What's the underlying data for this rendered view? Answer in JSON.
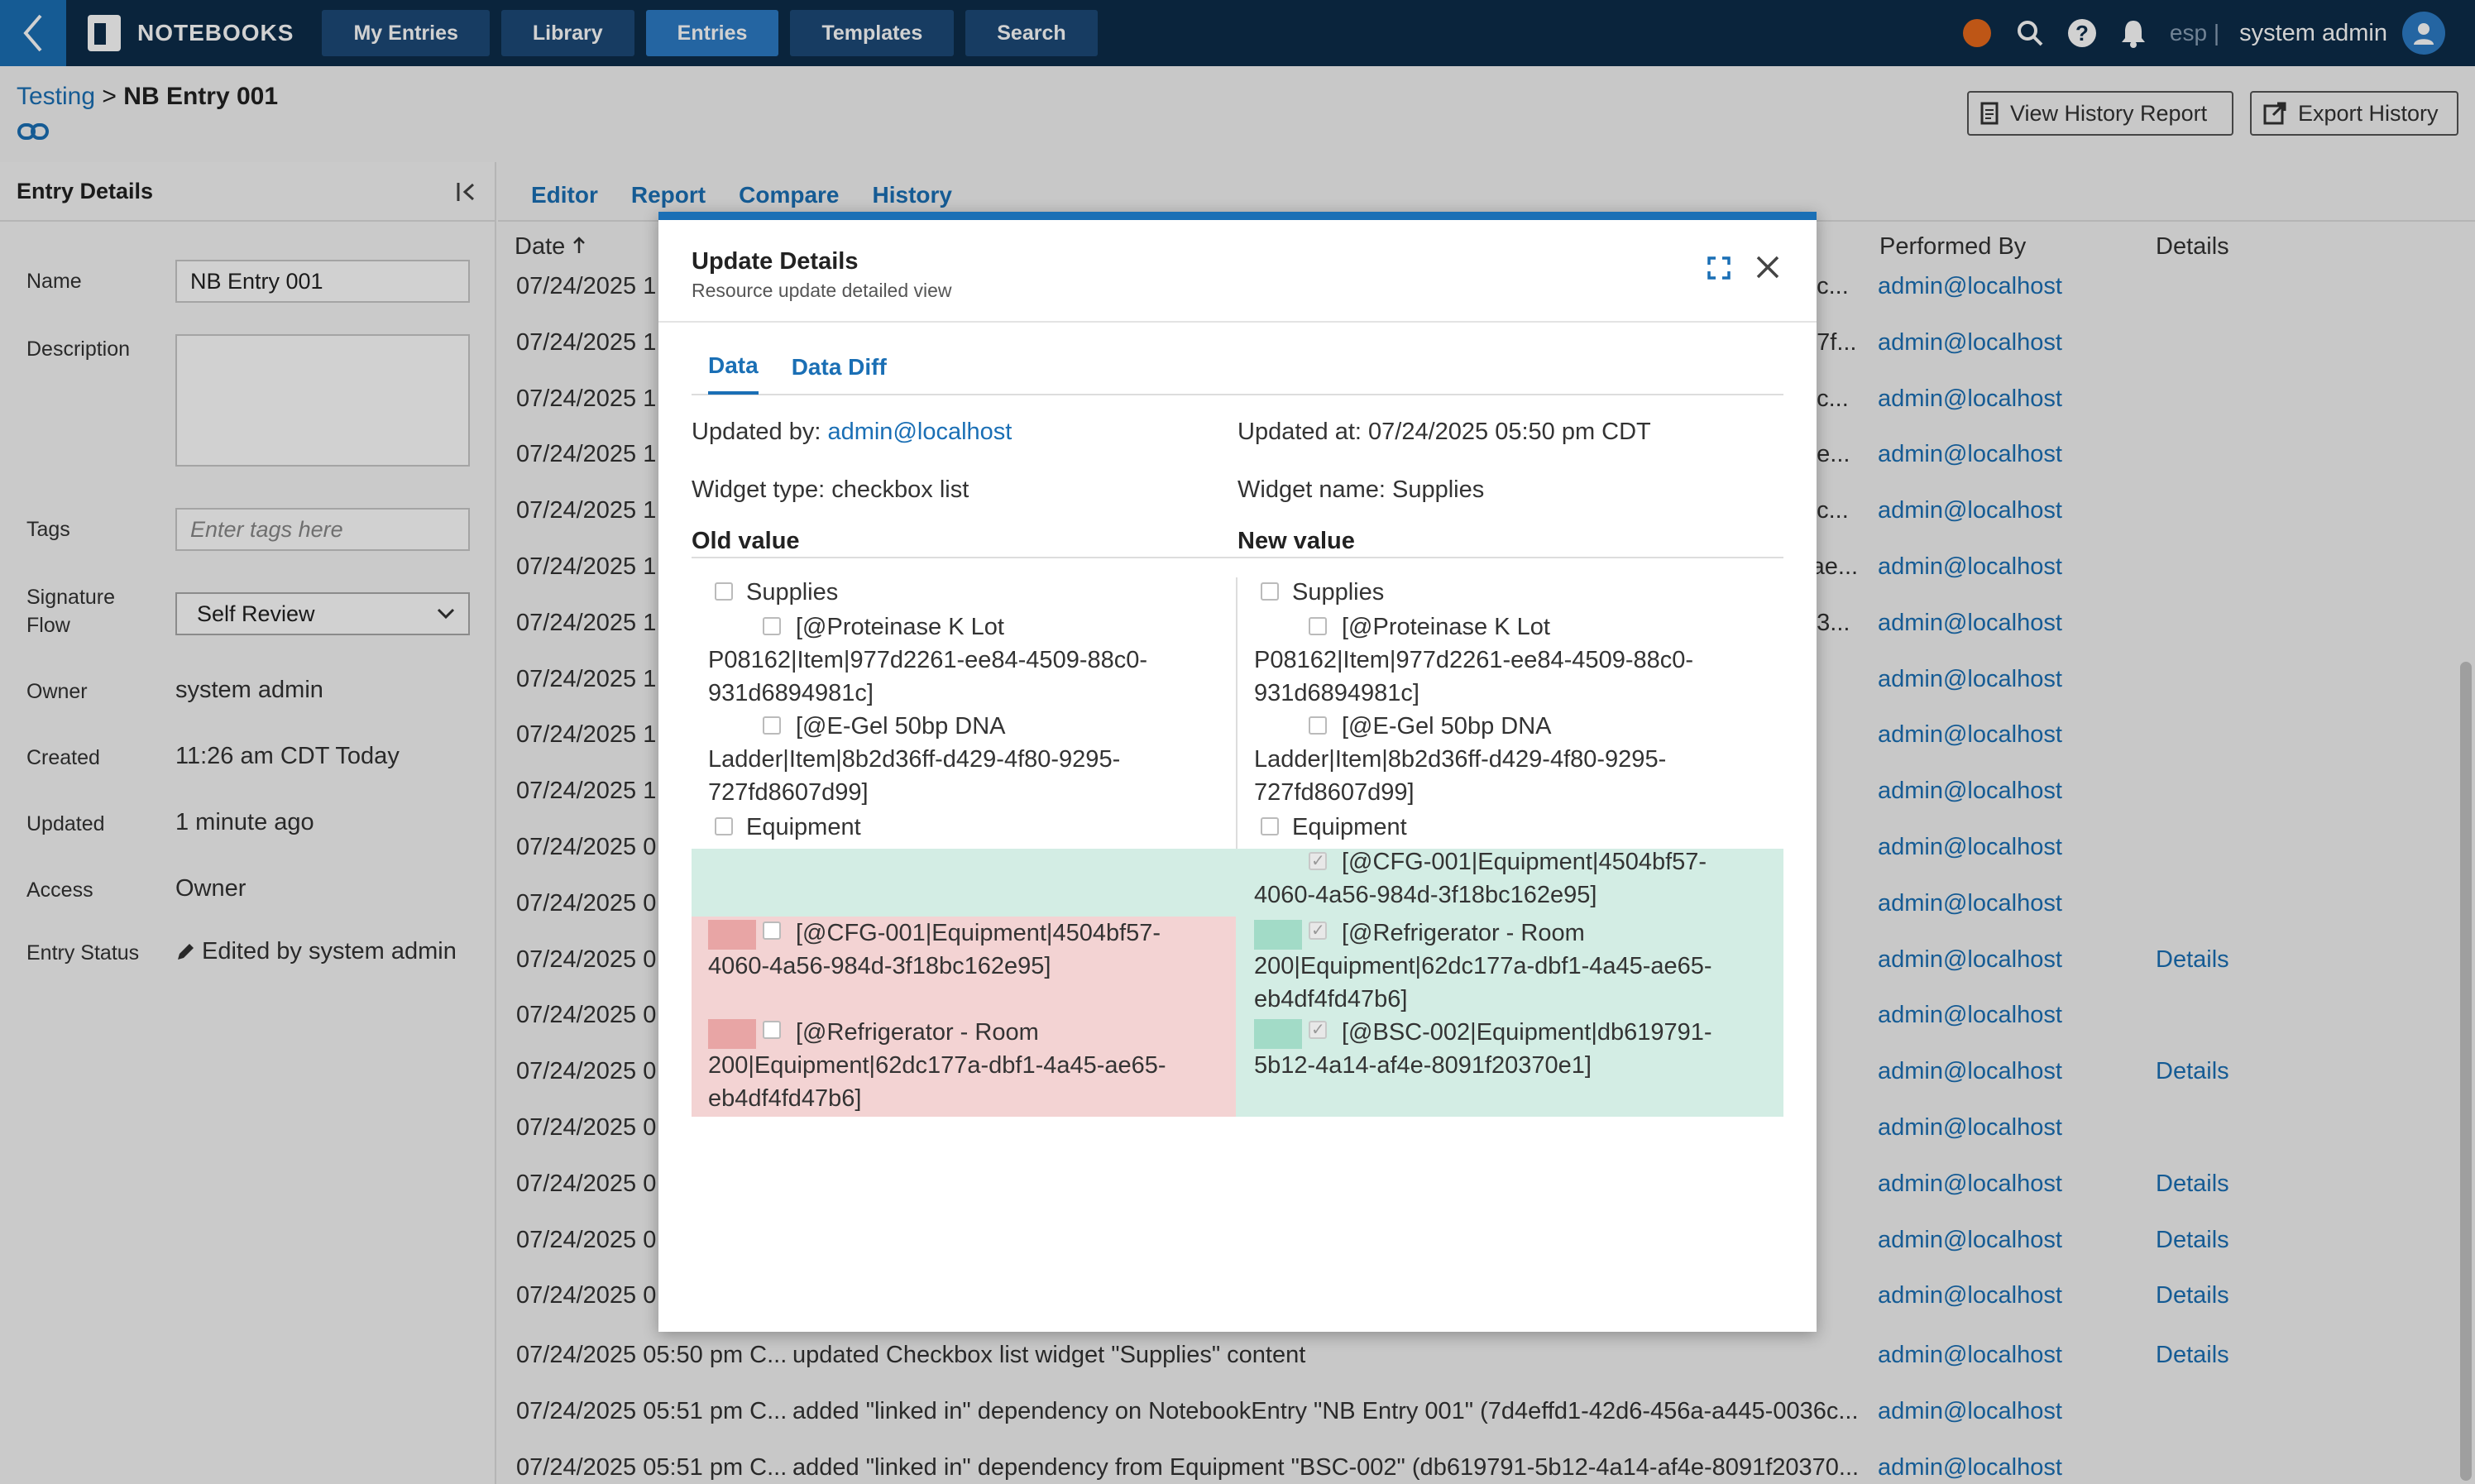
{
  "topbar": {
    "brand": "NOTEBOOKS",
    "nav": [
      "My Entries",
      "Library",
      "Entries",
      "Templates",
      "Search"
    ],
    "active_nav": "Entries",
    "lang": "esp |",
    "user": "system admin",
    "colors": {
      "bar": "#0d2c4a",
      "accent": "#1a6fb5",
      "status_dot": "#e86a1c"
    }
  },
  "breadcrumb": {
    "parent": "Testing",
    "sep": ">",
    "current": "NB Entry 001"
  },
  "header_buttons": {
    "view_history": "View History Report",
    "export_history": "Export History"
  },
  "left_panel": {
    "title": "Entry Details",
    "name_label": "Name",
    "name_value": "NB Entry 001",
    "description_label": "Description",
    "tags_label": "Tags",
    "tags_placeholder": "Enter tags here",
    "signature_label_1": "Signature",
    "signature_label_2": "Flow",
    "signature_value": "Self Review",
    "owner_label": "Owner",
    "owner_value": "system admin",
    "created_label": "Created",
    "created_value": "11:26 am CDT Today",
    "updated_label": "Updated",
    "updated_value": "1 minute ago",
    "access_label": "Access",
    "access_value": "Owner",
    "status_label": "Entry Status",
    "status_value": "Edited by system admin"
  },
  "main_tabs": [
    "Editor",
    "Report",
    "Compare",
    "History"
  ],
  "table": {
    "headers": {
      "date": "Date",
      "performed_by": "Performed By",
      "details": "Details"
    },
    "rows": [
      {
        "date": "07/24/2025 1",
        "frag": "6c...",
        "by": "admin@localhost",
        "details": ""
      },
      {
        "date": "07/24/2025 1",
        "frag": "27f...",
        "by": "admin@localhost",
        "details": ""
      },
      {
        "date": "07/24/2025 1",
        "frag": "6c...",
        "by": "admin@localhost",
        "details": ""
      },
      {
        "date": "07/24/2025 1",
        "frag": "2e...",
        "by": "admin@localhost",
        "details": ""
      },
      {
        "date": "07/24/2025 1",
        "frag": "6c...",
        "by": "admin@localhost",
        "details": ""
      },
      {
        "date": "07/24/2025 1",
        "frag": "-ae...",
        "by": "admin@localhost",
        "details": ""
      },
      {
        "date": "07/24/2025 1",
        "frag": "03...",
        "by": "admin@localhost",
        "details": ""
      },
      {
        "date": "07/24/2025 1",
        "frag": "",
        "by": "admin@localhost",
        "details": ""
      },
      {
        "date": "07/24/2025 1",
        "frag": "\"",
        "by": "admin@localhost",
        "details": ""
      },
      {
        "date": "07/24/2025 1",
        "frag": "",
        "by": "admin@localhost",
        "details": ""
      },
      {
        "date": "07/24/2025 0",
        "frag": "",
        "by": "admin@localhost",
        "details": ""
      },
      {
        "date": "07/24/2025 0",
        "frag": "",
        "by": "admin@localhost",
        "details": ""
      },
      {
        "date": "07/24/2025 0",
        "frag": "",
        "by": "admin@localhost",
        "details": "Details"
      },
      {
        "date": "07/24/2025 0",
        "frag": "",
        "by": "admin@localhost",
        "details": ""
      },
      {
        "date": "07/24/2025 0",
        "frag": "",
        "by": "admin@localhost",
        "details": "Details"
      },
      {
        "date": "07/24/2025 0",
        "frag": "",
        "by": "admin@localhost",
        "details": ""
      },
      {
        "date": "07/24/2025 0",
        "frag": "",
        "by": "admin@localhost",
        "details": "Details"
      },
      {
        "date": "07/24/2025 0",
        "frag": "",
        "by": "admin@localhost",
        "details": "Details"
      },
      {
        "date": "07/24/2025 0",
        "frag": "",
        "by": "admin@localhost",
        "details": "Details"
      }
    ],
    "bottom_rows": [
      {
        "date": "07/24/2025 05:50 pm C...",
        "desc": "updated Checkbox list widget \"Supplies\" content",
        "by": "admin@localhost",
        "details": "Details"
      },
      {
        "date": "07/24/2025 05:51 pm C...",
        "desc": "added \"linked in\" dependency on NotebookEntry \"NB Entry 001\" (7d4effd1-42d6-456a-a445-0036c...",
        "by": "admin@localhost",
        "details": ""
      },
      {
        "date": "07/24/2025 05:51 pm C...",
        "desc": "added \"linked in\" dependency from Equipment \"BSC-002\" (db619791-5b12-4a14-af4e-8091f20370...",
        "by": "admin@localhost",
        "details": ""
      }
    ]
  },
  "modal": {
    "title": "Update Details",
    "subtitle": "Resource update detailed view",
    "tabs": [
      "Data",
      "Data Diff"
    ],
    "updated_by_label": "Updated by:",
    "updated_by": "admin@localhost",
    "updated_at": "Updated at: 07/24/2025 05:50 pm CDT",
    "widget_type": "Widget type: checkbox list",
    "widget_name": "Widget name: Supplies",
    "old_header": "Old value",
    "new_header": "New value",
    "common_lines": {
      "supplies": "Supplies",
      "pk_1": "[@Proteinase K Lot",
      "pk_2": "P08162|Item|977d2261-ee84-4509-88c0-",
      "pk_3": "931d6894981c]",
      "egel_1": "[@E-Gel 50bp DNA",
      "egel_2": "Ladder|Item|8b2d36ff-d429-4f80-9295-",
      "egel_3": "727fd8607d99]",
      "equipment": "Equipment"
    },
    "old_removed": {
      "cfg_1": "[@CFG-001|Equipment|4504bf57-",
      "cfg_2": "4060-4a56-984d-3f18bc162e95]",
      "ref_1": "[@Refrigerator - Room",
      "ref_2": "200|Equipment|62dc177a-dbf1-4a45-ae65-",
      "ref_3": "eb4df4fd47b6]"
    },
    "new_added": {
      "cfg_1": "[@CFG-001|Equipment|4504bf57-",
      "cfg_2": "4060-4a56-984d-3f18bc162e95]",
      "ref_1": "[@Refrigerator - Room",
      "ref_2": "200|Equipment|62dc177a-dbf1-4a45-ae65-",
      "ref_3": "eb4df4fd47b6]",
      "bsc_1": "[@BSC-002|Equipment|db619791-",
      "bsc_2": "5b12-4a14-af4e-8091f20370e1]"
    },
    "colors": {
      "removed_bg": "#f3d3d3",
      "removed_mark": "#e8a5a5",
      "added_bg": "#d3ede4",
      "added_mark": "#a2dbc7"
    }
  }
}
